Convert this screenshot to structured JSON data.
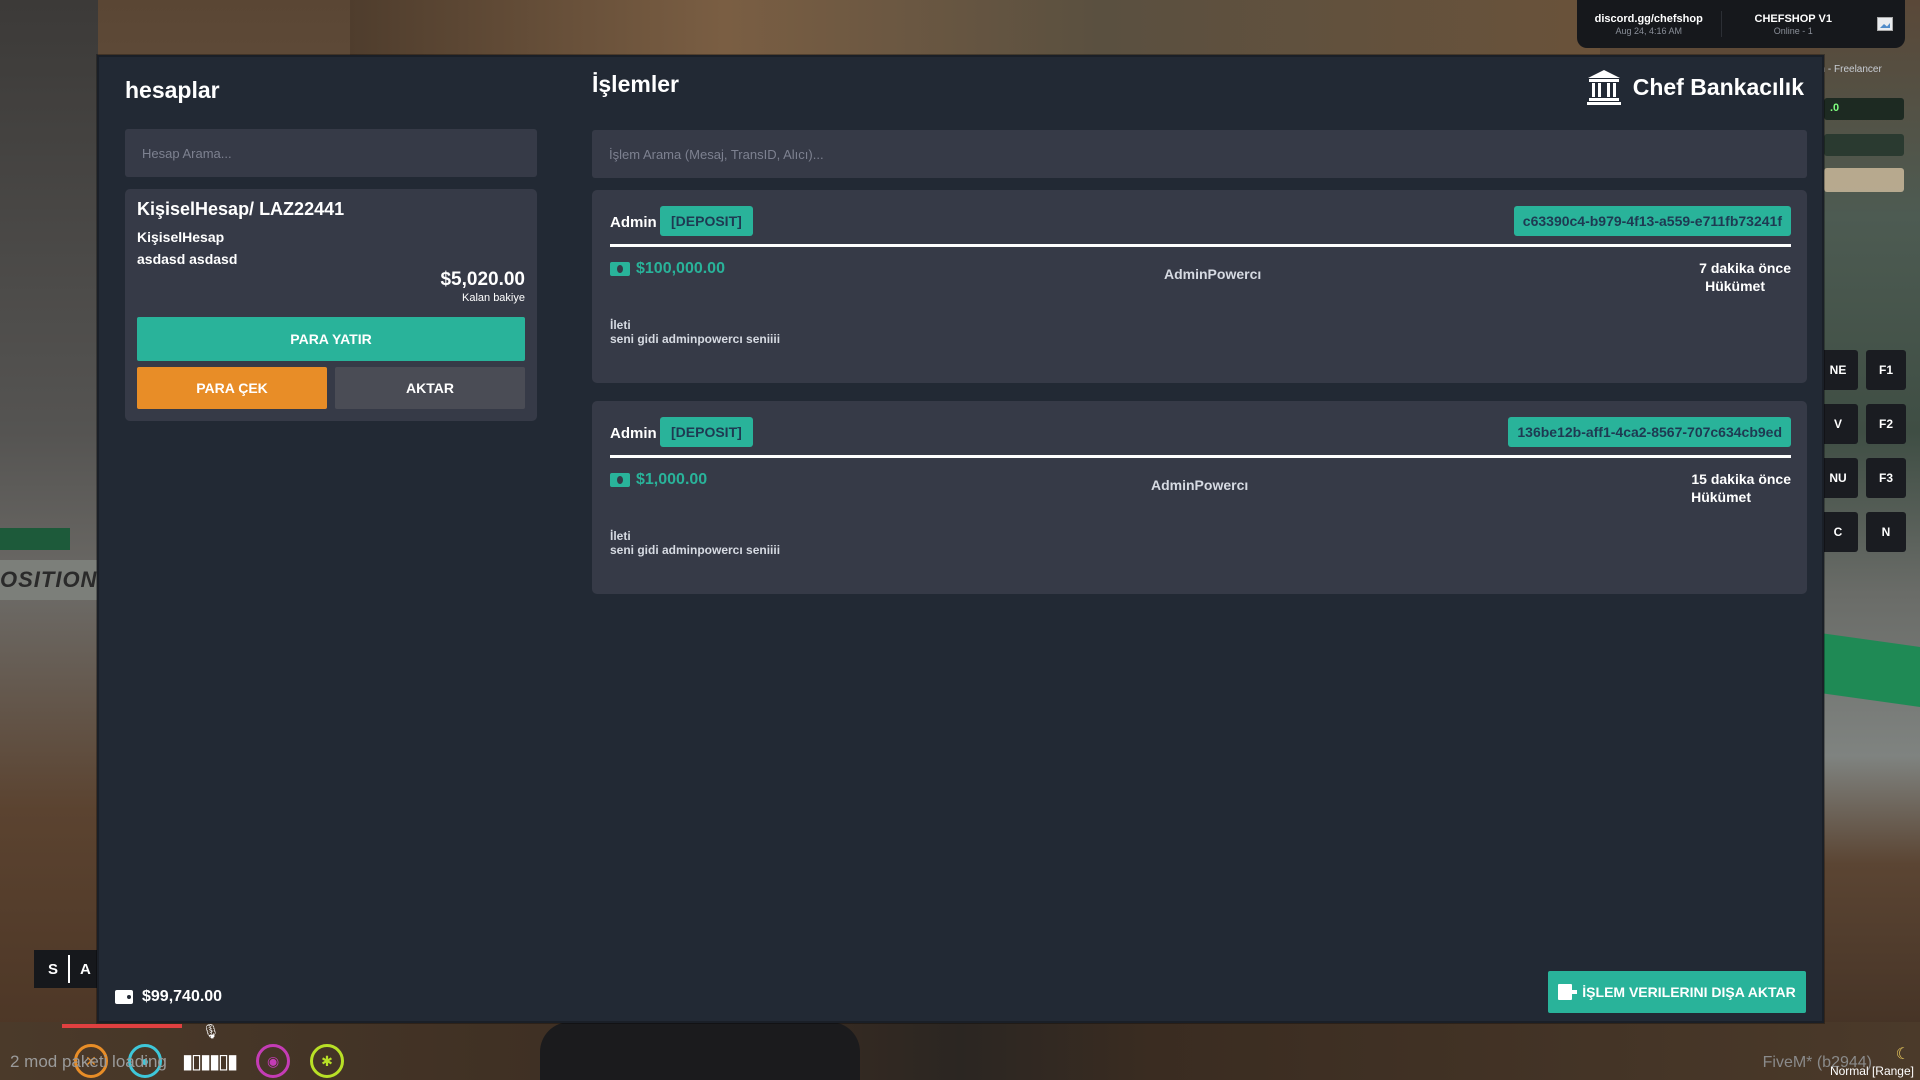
{
  "server": {
    "discord": "discord.gg/chefshop",
    "datetime": "Aug 24, 4:16 AM",
    "name": "CHEFSHOP V1",
    "online": "Online - 1"
  },
  "job": {
    "title": "an - Freelancer",
    "money_fragment": ".0"
  },
  "keybinds": [
    [
      "NE",
      "F1"
    ],
    [
      "V",
      "F2"
    ],
    [
      "NU",
      "F3"
    ],
    [
      "C",
      "N"
    ]
  ],
  "hud": {
    "gear": "S",
    "gear_side": "A",
    "mods_status": "2 mod paketi loading",
    "fivem_version": "FiveM* (b2944)",
    "voice_mode": "Normal [Range]"
  },
  "left_sign": "OSITION C",
  "accounts": {
    "title": "hesaplar",
    "search_placeholder": "Hesap Arama...",
    "card": {
      "name": "KişiselHesap/ LAZ22441",
      "type": "KişiselHesap",
      "owner": "asdasd asdasd",
      "balance": "$5,020.00",
      "balance_label": "Kalan bakiye",
      "deposit_label": "PARA YATIR",
      "withdraw_label": "PARA ÇEK",
      "transfer_label": "AKTAR"
    }
  },
  "transactions": {
    "title": "İşlemler",
    "search_placeholder": "İşlem Arama (Mesaj, TransID, Alıcı)...",
    "items": [
      {
        "issuer": "Admin",
        "tag": "[DEPOSIT]",
        "trans_id": "c63390c4-b979-4f13-a559-e711fb73241f",
        "amount": "$100,000.00",
        "receiver": "AdminPowercı",
        "time": "7 dakika önce",
        "source": "Hükümet",
        "message_label": "İleti",
        "message": "seni gidi adminpowercı seniiii"
      },
      {
        "issuer": "Admin",
        "tag": "[DEPOSIT]",
        "trans_id": "136be12b-aff1-4ca2-8567-707c634cb9ed",
        "amount": "$1,000.00",
        "receiver": "AdminPowercı",
        "time": "15 dakika önce",
        "source": "Hükümet",
        "message_label": "İleti",
        "message": "seni gidi adminpowercı seniiii"
      }
    ]
  },
  "brand": {
    "name": "Chef Bankacılık",
    "icon": "bank-icon"
  },
  "wallet": {
    "cash": "$99,740.00",
    "icon": "wallet-icon"
  },
  "export_label": "İŞLEM VERILERINI DIŞA AKTAR",
  "colors": {
    "panel_bg": "#222934",
    "card_bg": "#363a47",
    "accent_teal": "#29b39a",
    "accent_orange": "#e88d27",
    "neutral_button": "#4a4c55",
    "tag_text": "#1e3a52"
  }
}
